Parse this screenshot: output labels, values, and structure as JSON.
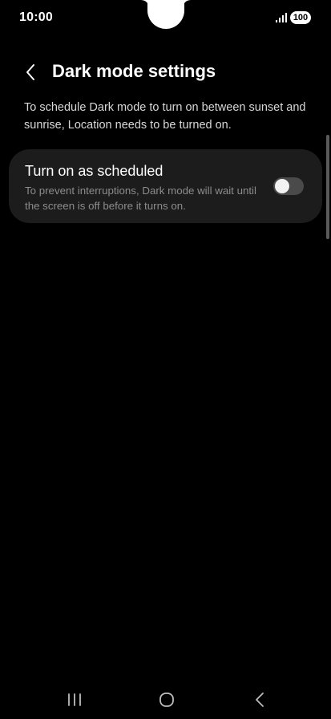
{
  "status_bar": {
    "time": "10:00",
    "battery": "100",
    "signal_icon": "signal-bars-icon"
  },
  "header": {
    "back_icon": "chevron-left-icon",
    "title": "Dark mode settings"
  },
  "description": "To schedule Dark mode to turn on between sunset and sunrise, Location needs to be turned on.",
  "setting": {
    "title": "Turn on as scheduled",
    "subtitle": "To prevent interruptions, Dark mode will wait until the screen is off before it turns on.",
    "toggle_on": false
  },
  "nav_bar": {
    "recents_icon": "recents-icon",
    "home_icon": "home-icon",
    "back_icon": "back-icon"
  },
  "colors": {
    "background": "#000000",
    "card": "#1c1c1c",
    "toggle_off": "#4a4a4a",
    "text_primary": "#ffffff",
    "text_secondary": "#8c8c8c"
  }
}
